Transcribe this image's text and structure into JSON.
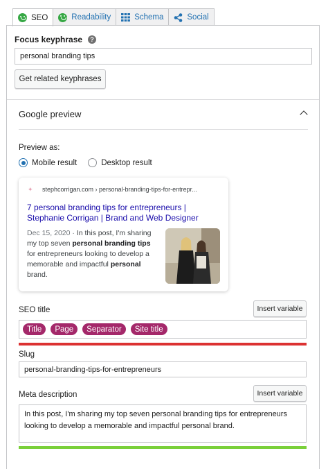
{
  "tabs": [
    {
      "label": "SEO",
      "icon": "green-smiley-icon"
    },
    {
      "label": "Readability",
      "icon": "green-smiley-icon"
    },
    {
      "label": "Schema",
      "icon": "grid-icon"
    },
    {
      "label": "Social",
      "icon": "share-icon"
    }
  ],
  "focus": {
    "label": "Focus keyphrase",
    "help": "?",
    "value": "personal branding tips",
    "related_button": "Get related keyphrases"
  },
  "google_preview": {
    "title": "Google preview",
    "preview_as": "Preview as:",
    "options": [
      "Mobile result",
      "Desktop result"
    ],
    "selected": "Mobile result",
    "breadcrumb": "stephcorrigan.com › personal-branding-tips-for-entrepr...",
    "serp_title": "7 personal branding tips for entrepreneurs | Stephanie Corrigan | Brand and Web Designer",
    "date": "Dec 15, 2020",
    "date_sep": " · ",
    "desc_parts": [
      "In this post, I'm sharing my top seven ",
      "personal branding tips",
      " for entrepreneurs looking to develop a memorable and impactful ",
      "personal",
      " brand."
    ]
  },
  "seo_title": {
    "label": "SEO title",
    "insert_button": "Insert variable",
    "variables": [
      "Title",
      "Page",
      "Separator",
      "Site title"
    ],
    "progress_color": "#dc3232"
  },
  "slug": {
    "label": "Slug",
    "value": "personal-branding-tips-for-entrepreneurs"
  },
  "meta": {
    "label": "Meta description",
    "insert_button": "Insert variable",
    "value": "In this post, I'm sharing my top seven personal branding tips for entrepreneurs looking to develop a memorable and impactful personal brand.",
    "progress_color": "#7ad03a"
  }
}
